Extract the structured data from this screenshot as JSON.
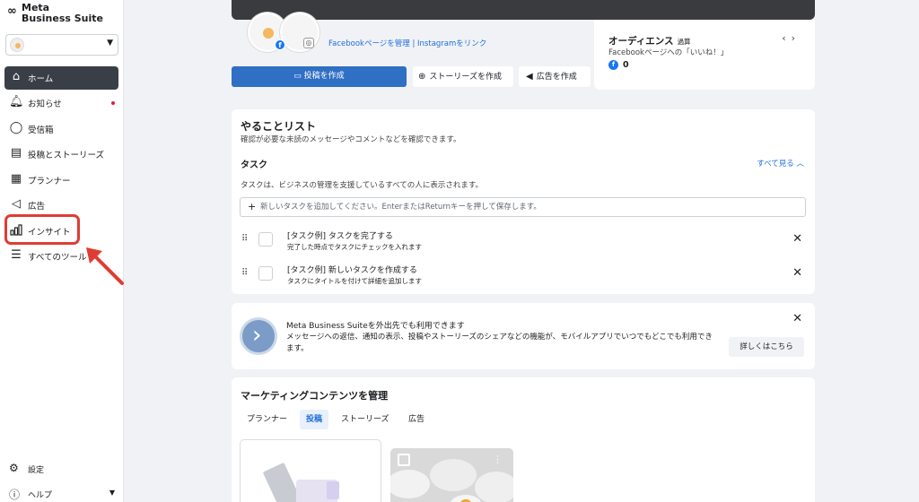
{
  "app": {
    "brand_line1": "Meta",
    "brand_line2": "Business Suite"
  },
  "sidebar": {
    "items": [
      {
        "label": "ホーム",
        "icon": "home-icon"
      },
      {
        "label": "お知らせ",
        "icon": "bell-icon"
      },
      {
        "label": "受信箱",
        "icon": "chat-bubble-icon"
      },
      {
        "label": "投稿とストーリーズ",
        "icon": "posts-icon"
      },
      {
        "label": "プランナー",
        "icon": "calendar-icon"
      },
      {
        "label": "広告",
        "icon": "megaphone-icon"
      },
      {
        "label": "インサイト",
        "icon": "bar-chart-icon"
      },
      {
        "label": "すべてのツール",
        "icon": "hamburger-menu-icon"
      }
    ],
    "bottom": {
      "settings_label": "設定",
      "help_label": "ヘルプ"
    }
  },
  "profile": {
    "link_text": "Facebookページを管理 | Instagramをリンク"
  },
  "actions": {
    "create_post": "投稿を作成",
    "create_story": "ストーリーズを作成",
    "create_ad": "広告を作成"
  },
  "audience": {
    "title": "オーディエンス",
    "period": "過算",
    "subtitle": "Facebookページへの「いいね！」",
    "value": "0"
  },
  "todo": {
    "title": "やることリスト",
    "subtitle": "確認が必要な未読のメッセージやコメントなどを確認できます。",
    "tasks_heading": "タスク",
    "see_all": "すべて見る",
    "note": "タスクは、ビジネスの管理を支援しているすべての人に表示されます。",
    "input_placeholder": "新しいタスクを追加してください。EnterまたはReturnキーを押して保存します。",
    "items": [
      {
        "title": "[タスク例] タスクを完了する",
        "desc": "完了した時点でタスクにチェックを入れます"
      },
      {
        "title": "[タスク例] 新しいタスクを作成する",
        "desc": "タスクにタイトルを付けて詳細を追加します"
      }
    ]
  },
  "promo": {
    "title": "Meta Business Suiteを外出先でも利用できます",
    "body": "メッセージへの返信、通知の表示、投稿やストーリーズのシェアなどの機能が、モバイルアプリでいつでもどこでも利用できます。",
    "button": "詳しくはこちら"
  },
  "marketing": {
    "title": "マーケティングコンテンツを管理",
    "tabs": [
      "プランナー",
      "投稿",
      "ストーリーズ",
      "広告"
    ],
    "active_tab": "投稿"
  },
  "colors": {
    "accent": "#2f6fc4",
    "highlight": "#e03c31",
    "sidebar_active": "#3a3f47"
  }
}
